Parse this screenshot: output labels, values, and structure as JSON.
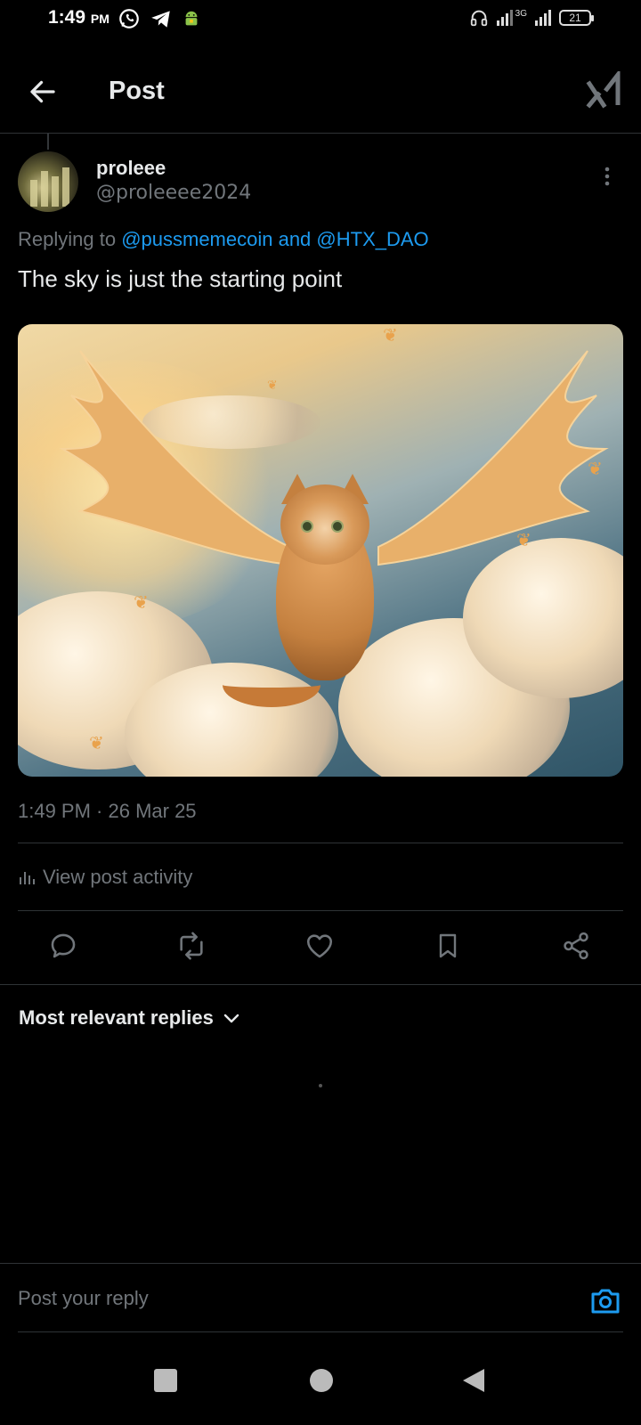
{
  "status_bar": {
    "time": "1:49",
    "ampm": "PM",
    "network": "3G",
    "battery": "21"
  },
  "header": {
    "title": "Post"
  },
  "post": {
    "display_name": "proleee",
    "handle": "@proleeee2024",
    "replying_prefix": "Replying to ",
    "replying_mentions": "@pussmemecoin and @HTX_DAO",
    "text": "The sky is just the starting point",
    "timestamp": "1:49 PM · 26 Mar 25",
    "view_activity": "View post activity"
  },
  "replies": {
    "sort_label": "Most relevant replies"
  },
  "composer": {
    "placeholder": "Post your reply"
  },
  "colors": {
    "background": "#000000",
    "text_primary": "#e7e9ea",
    "text_secondary": "#71767b",
    "accent": "#1d9bf0",
    "divider": "#2f3336"
  },
  "icons": {
    "back": "arrow-left-icon",
    "grok": "grok-icon",
    "more": "more-vertical-icon",
    "activity": "bar-chart-icon",
    "reply": "reply-icon",
    "repost": "repost-icon",
    "like": "heart-icon",
    "bookmark": "bookmark-icon",
    "share": "share-icon",
    "chevron": "chevron-down-icon",
    "camera": "camera-icon"
  }
}
